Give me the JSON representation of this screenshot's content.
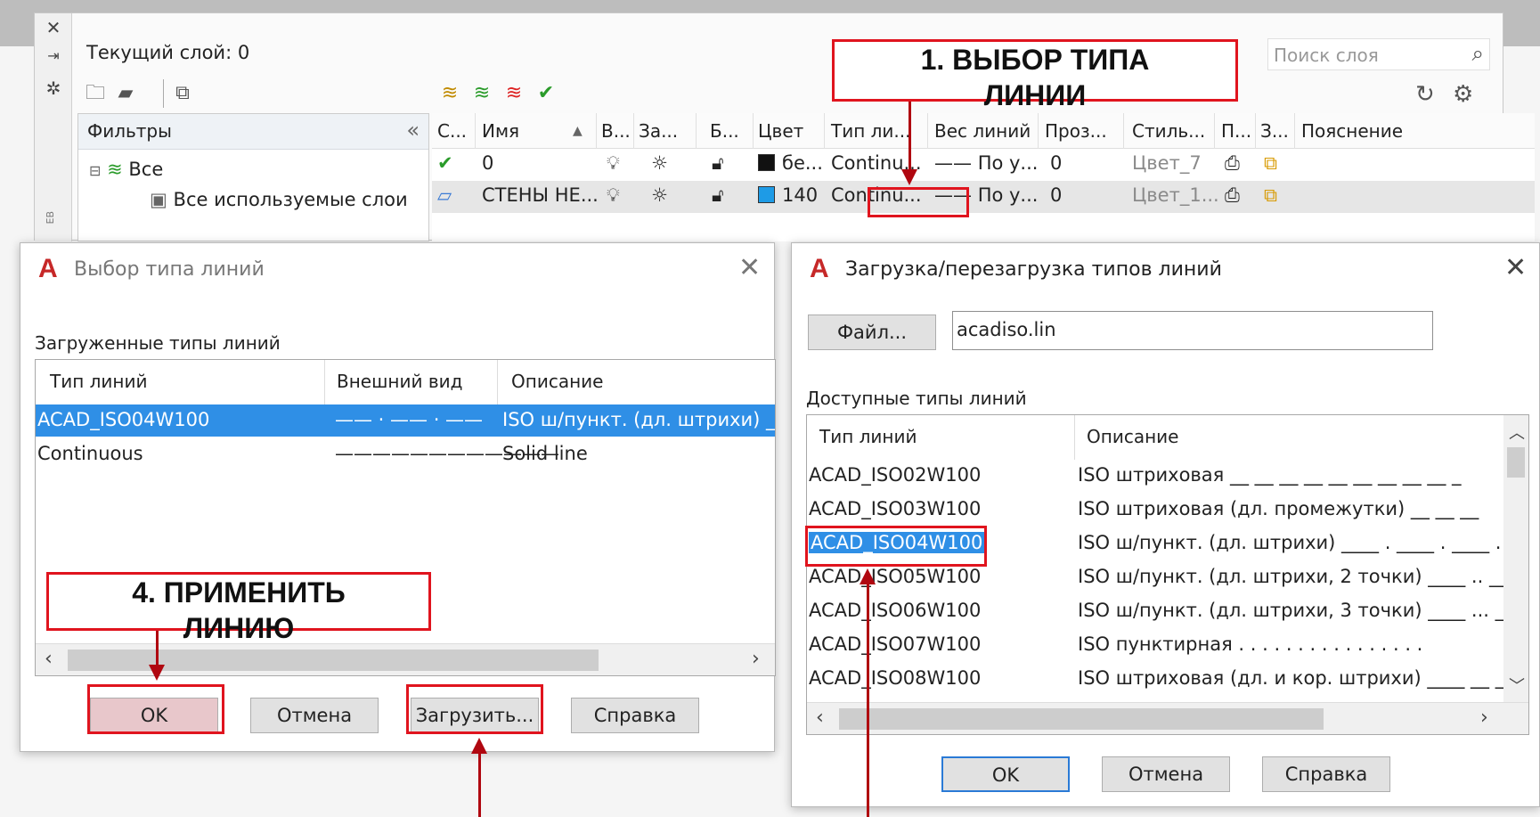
{
  "layer_manager": {
    "current_layer": "Текущий слой: 0",
    "search_placeholder": "Поиск слоя",
    "filters": {
      "title": "Фильтры",
      "all": "Все",
      "used": "Все используемые слои"
    },
    "side_label": "ЕВ",
    "columns": [
      "С...",
      "Имя",
      "В...",
      "За...",
      "Б...",
      "Цвет",
      "Тип ли...",
      "Вес линий",
      "Проз...",
      "Стиль...",
      "П...",
      "З...",
      "Пояснение"
    ],
    "rows": [
      {
        "name": "0",
        "color_name": "бе...",
        "color_hex": "#111111",
        "linetype": "Continu...",
        "lineweight": "По у...",
        "transparency": "0",
        "plot_style": "Цвет_7"
      },
      {
        "name": "СТЕНЫ НЕ...",
        "color_name": "140",
        "color_hex": "#1e9be6",
        "linetype": "Continu...",
        "lineweight": "По у...",
        "transparency": "0",
        "plot_style": "Цвет_1..."
      }
    ]
  },
  "select_dialog": {
    "title": "Выбор типа линий",
    "loaded_label": "Загруженные типы линий",
    "columns": [
      "Тип линий",
      "Внешний вид",
      "Описание"
    ],
    "rows": [
      {
        "name": "ACAD_ISO04W100",
        "preview": "—— · —— · ——",
        "desc": "ISO ш/пункт. (дл. штрихи) ____"
      },
      {
        "name": "Continuous",
        "preview": "————————————",
        "desc": "Solid line"
      }
    ],
    "buttons": {
      "ok": "OK",
      "cancel": "Отмена",
      "load": "Загрузить...",
      "help": "Справка"
    }
  },
  "load_dialog": {
    "title": "Загрузка/перезагрузка типов линий",
    "file_button": "Файл...",
    "file_value": "acadiso.lin",
    "available_label": "Доступные типы линий",
    "columns": [
      "Тип линий",
      "Описание"
    ],
    "rows": [
      {
        "name": "ACAD_ISO02W100",
        "desc": "ISO штриховая __ __ __ __ __ __ __ __ __ _"
      },
      {
        "name": "ACAD_ISO03W100",
        "desc": "ISO штриховая (дл. промежутки) __    __    __"
      },
      {
        "name": "ACAD_ISO04W100",
        "desc": "ISO ш/пункт. (дл. штрихи) ____ . ____ . ____ ."
      },
      {
        "name": "ACAD_ISO05W100",
        "desc": "ISO ш/пункт. (дл. штрихи, 2 точки) ____ .. ____"
      },
      {
        "name": "ACAD_ISO06W100",
        "desc": "ISO ш/пункт. (дл. штрихи, 3 точки) ____ ... ___"
      },
      {
        "name": "ACAD_ISO07W100",
        "desc": "ISO пунктирная . . . . . . . . . . . . . . . ."
      },
      {
        "name": "ACAD_ISO08W100",
        "desc": "ISO штриховая (дл. и кор. штрихи) ____ __ ____"
      }
    ],
    "buttons": {
      "ok": "OK",
      "cancel": "Отмена",
      "help": "Справка"
    }
  },
  "annotations": {
    "step1_line1": "1. ВЫБОР ТИПА",
    "step1_line2": "ЛИНИИ",
    "step4_line1": "4. ПРИМЕНИТЬ",
    "step4_line2": "ЛИНИЮ"
  },
  "colors": {
    "annotation_red": "#e0141e",
    "selection_blue": "#2f8fe6",
    "autocad_red": "#c62828"
  }
}
